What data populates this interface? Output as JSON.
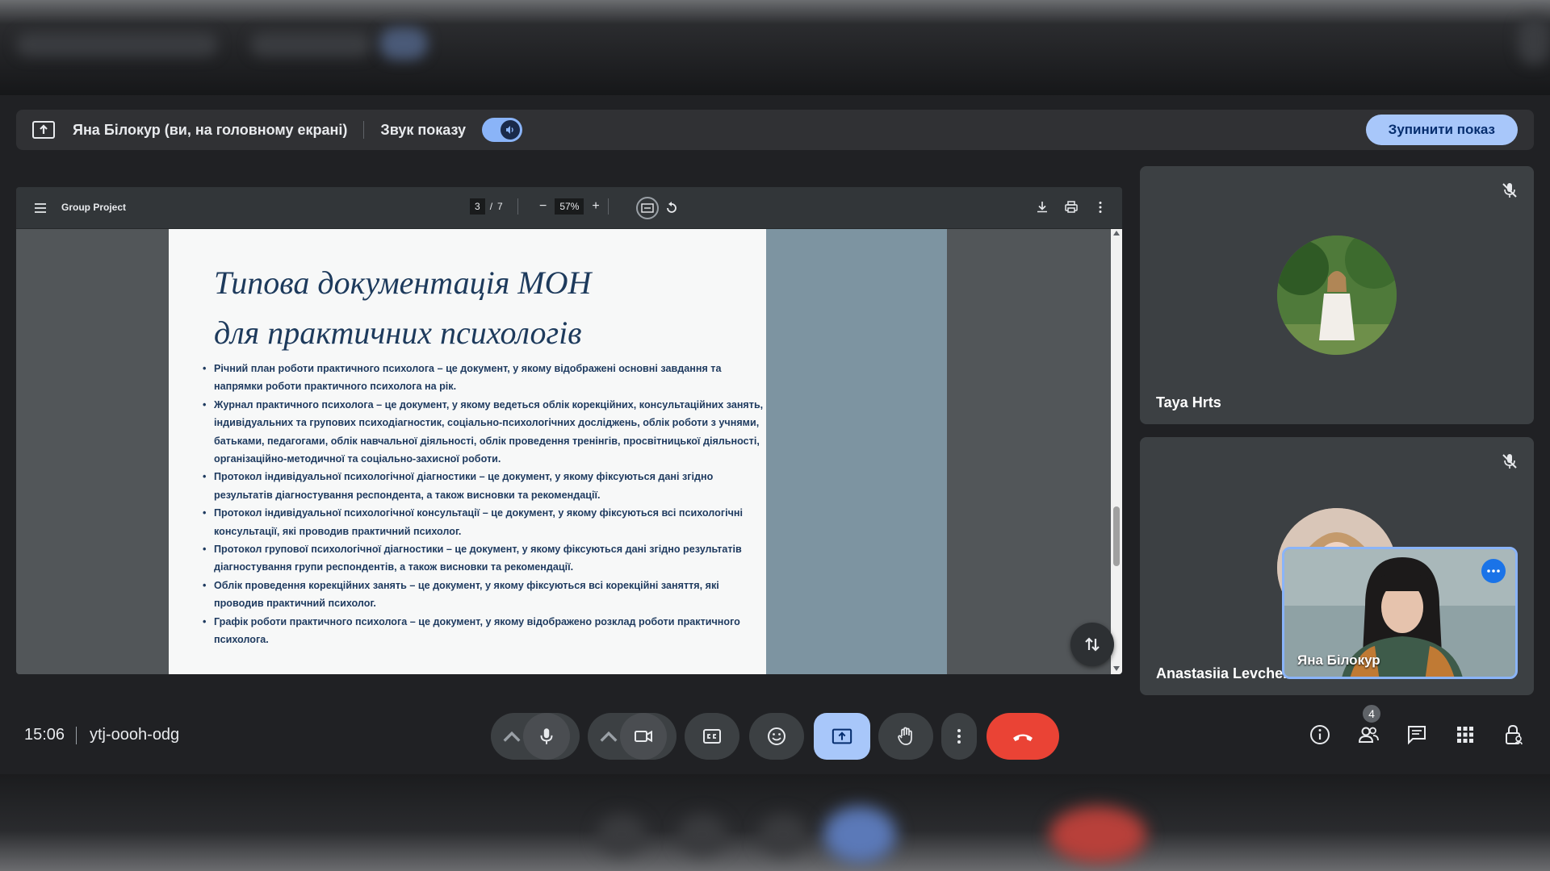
{
  "presenting_bar": {
    "presenter_text": "Яна Білокур (ви, на головному екрані)",
    "audio_label": "Звук показу",
    "audio_enabled": true,
    "stop_button": "Зупинити показ"
  },
  "pdf_viewer": {
    "doc_title": "Group Project",
    "current_page": "3",
    "total_pages": "7",
    "zoom": "57%",
    "zoom_out": "−",
    "zoom_in": "+",
    "slide": {
      "title_line1": "Типова документація МОН",
      "title_line2": "для практичних психологів",
      "bullets": [
        "Річний план роботи практичного психолога – це документ, у якому відображені основні завдання та напрямки роботи практичного психолога на рік.",
        "Журнал практичного психолога – це документ, у якому ведеться облік корекційних, консультаційних занять, індивідуальних та групових психодіагностик, соціально-психологічних досліджень, облік роботи з учнями, батьками, педагогами, облік навчальної діяльності, облік проведення тренінгів, просвітницької діяльності, організаційно-методичної та соціально-захисної роботи.",
        "Протокол індивідуальної психологічної діагностики – це документ, у якому фіксуються дані згідно результатів діагностування респондента, а також висновки та рекомендації.",
        "Протокол індивідуальної психологічної консультації – це документ, у якому фіксуються всі психологічні консультації, які проводив практичний психолог.",
        "Протокол групової психологічної діагностики – це документ, у якому фіксуються дані згідно результатів діагностування групи респондентів, а також висновки та рекомендації.",
        "Облік проведення корекційних занять – це документ, у якому фіксуються всі корекційні заняття, які проводив практичний психолог.",
        "Графік роботи практичного психолога – це документ, у якому відображено розклад роботи практичного психолога."
      ]
    }
  },
  "participants": [
    {
      "name": "Taya Hrts",
      "muted": true
    },
    {
      "name": "Anastasiia Levchenko",
      "muted": true
    }
  ],
  "self_view": {
    "name": "Яна Білокур"
  },
  "meeting": {
    "time": "15:06",
    "code": "ytj-oooh-odg",
    "participant_count": "4"
  },
  "colors": {
    "accent": "#8ab4f8",
    "present_active": "#a8c7fa",
    "end_call": "#ea4335",
    "slide_title": "#1d3a5c",
    "slide_side_panel": "#7d94a1"
  }
}
